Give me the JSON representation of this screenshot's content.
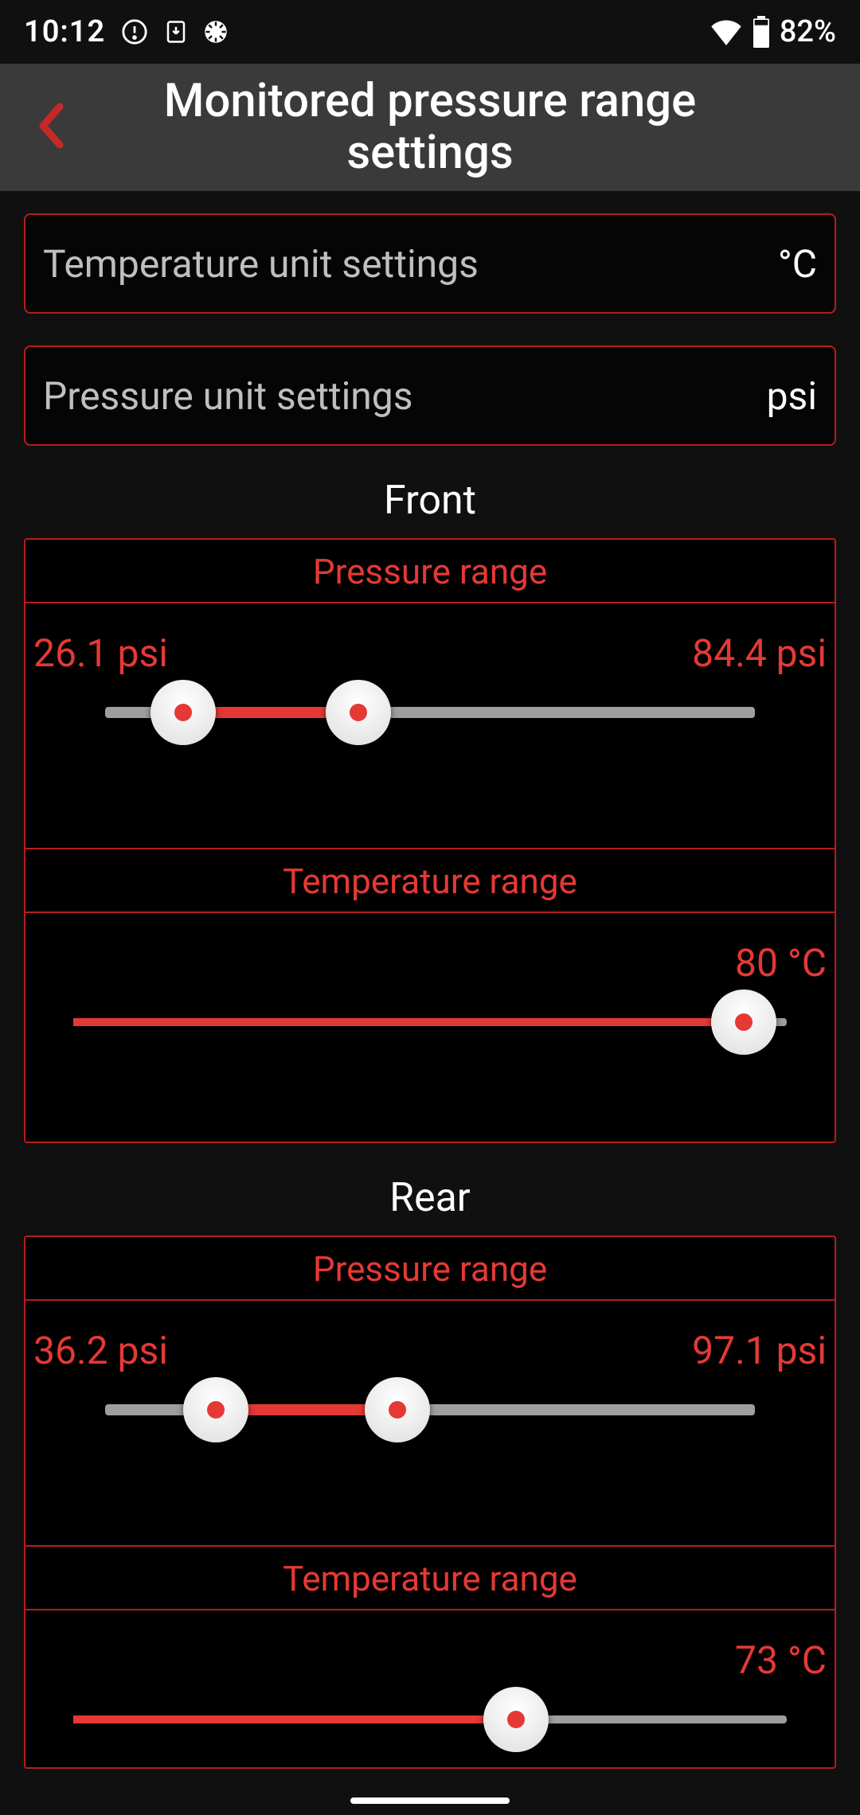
{
  "status": {
    "time": "10:12",
    "battery": "82%"
  },
  "header": {
    "title": "Monitored pressure range settings"
  },
  "settings": {
    "temp_unit": {
      "label": "Temperature unit settings",
      "value": "°C"
    },
    "press_unit": {
      "label": "Pressure unit settings",
      "value": "psi"
    }
  },
  "front": {
    "title": "Front",
    "pressure": {
      "heading": "Pressure range",
      "min_label": "26.1 psi",
      "max_label": "84.4 psi",
      "min_pct": 12,
      "max_pct": 39
    },
    "temperature": {
      "heading": "Temperature range",
      "max_label": "80 °C",
      "pct": 94
    }
  },
  "rear": {
    "title": "Rear",
    "pressure": {
      "heading": "Pressure range",
      "min_label": "36.2 psi",
      "max_label": "97.1 psi",
      "min_pct": 17,
      "max_pct": 45
    },
    "temperature": {
      "heading": "Temperature range",
      "max_label": "73 °C",
      "pct": 62
    }
  }
}
